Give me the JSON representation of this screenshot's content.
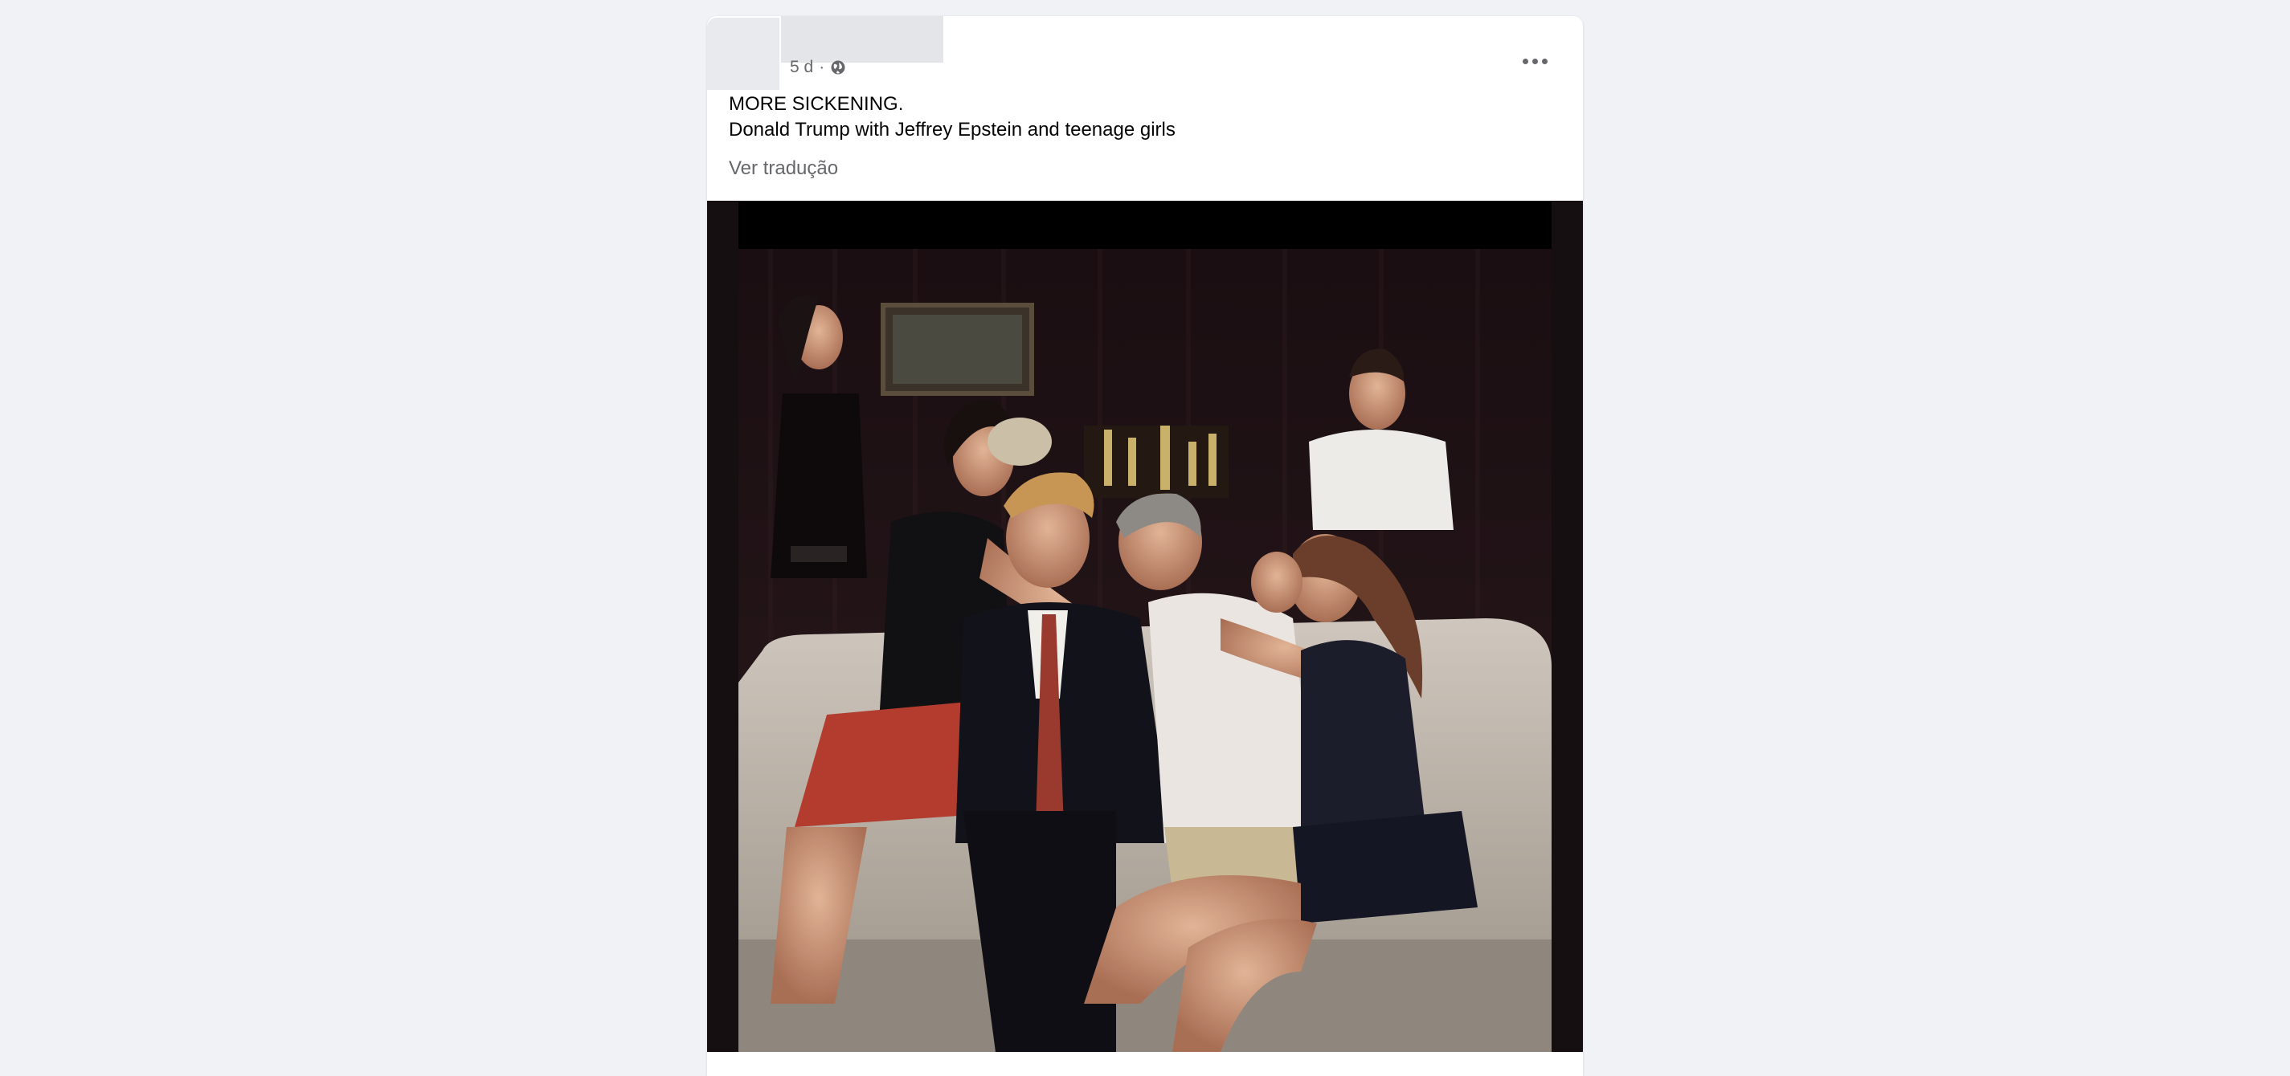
{
  "post": {
    "timestamp": "5 d",
    "separator": "·",
    "privacy_icon": "globe-icon",
    "more_icon": "more-horizontal-icon",
    "text_line1": "MORE SICKENING.",
    "text_line2": "Donald Trump with Jeffrey Epstein and teenage girls",
    "translate_label": "Ver tradução",
    "photo_description": "group-photo"
  },
  "colors": {
    "background": "#f0f2f5",
    "card": "#ffffff",
    "secondary_text": "#65676b",
    "primary_text": "#050505"
  }
}
